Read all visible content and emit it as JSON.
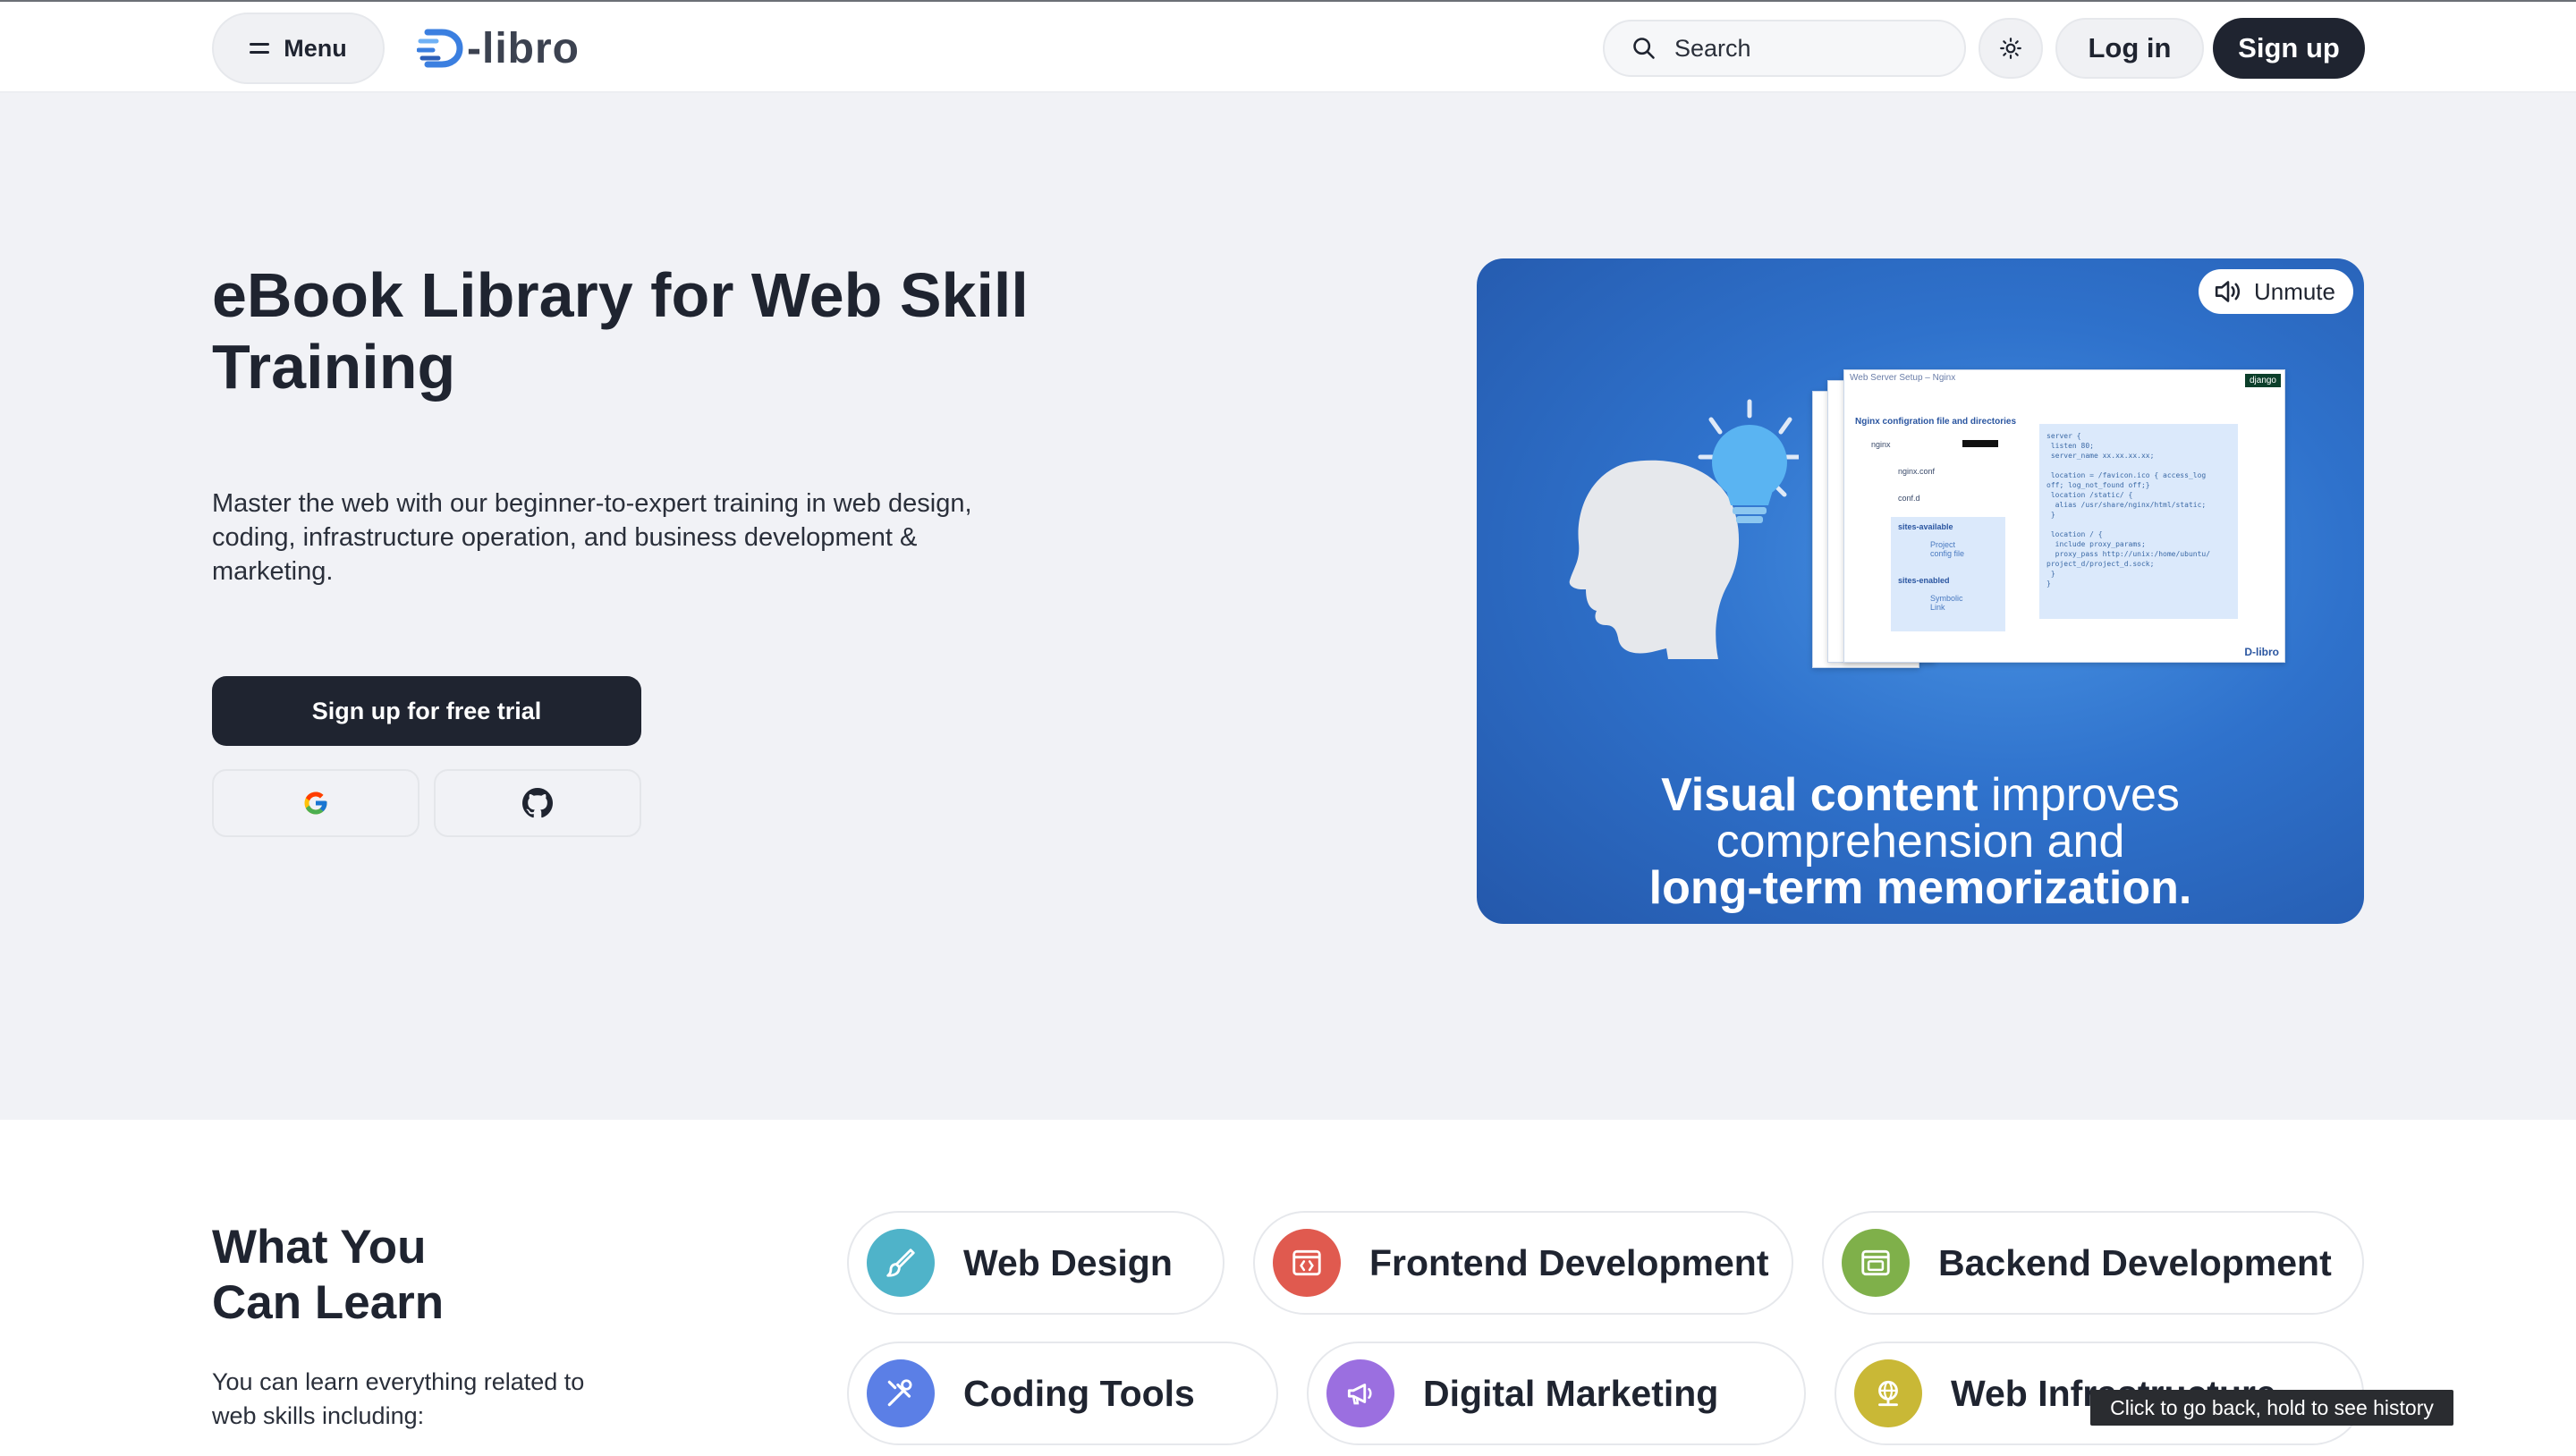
{
  "header": {
    "menu_label": "Menu",
    "logo_text": "-libro",
    "search_placeholder": "Search",
    "login_label": "Log in",
    "signup_label": "Sign up"
  },
  "hero": {
    "title": "eBook Library for Web Skill Training",
    "description": "Master the web with our beginner-to-expert training in web design, coding, infrastructure operation, and business development & marketing.",
    "cta_label": "Sign up for free trial",
    "video": {
      "unmute_label": "Unmute",
      "caption_line1_bold": "Visual content",
      "caption_line1_rest": " improves",
      "caption_line2": "comprehension and",
      "caption_line3_bold": "long-term memorization.",
      "doc_title": "Web Server Setup – Nginx",
      "doc_subtitle": "Nginx configration file and directories",
      "doc_badge": "django",
      "doc_brand": "D-libro",
      "tree_items": [
        "nginx",
        "nginx.conf",
        "conf.d",
        "sites-available",
        "Project config file",
        "sites-enabled",
        "Symbolic Link"
      ],
      "code_text": "server {\n listen 80;\n server_name xx.xx.xx.xx;\n\n location = /favicon.ico { access_log\noff; log_not_found off;}\n location /static/ {\n  alias /usr/share/nginx/html/static;\n }\n\n location / {\n  include proxy_params;\n  proxy_pass http://unix:/home/ubuntu/\nproject_d/project_d.sock;\n }\n}"
    }
  },
  "learn": {
    "title_line1": "What You",
    "title_line2": "Can Learn",
    "description": "You can learn everything related to web skills including:",
    "topics": [
      {
        "label": "Web Design",
        "color": "#4fb3c9",
        "icon": "brush-icon"
      },
      {
        "label": "Frontend Development",
        "color": "#e05a4f",
        "icon": "code-window-icon"
      },
      {
        "label": "Backend Development",
        "color": "#7fb04a",
        "icon": "server-window-icon"
      },
      {
        "label": "Coding Tools",
        "color": "#5b7fe6",
        "icon": "tools-icon"
      },
      {
        "label": "Digital Marketing",
        "color": "#9b6fe0",
        "icon": "megaphone-icon"
      },
      {
        "label": "Web Infrastructure",
        "color": "#c9b836",
        "icon": "globe-network-icon"
      }
    ]
  },
  "tooltip": "Click to go back, hold to see history",
  "colors": {
    "primary_dark": "#1f2430",
    "hero_bg": "#f1f2f6",
    "video_blue": "#2f72cc"
  }
}
